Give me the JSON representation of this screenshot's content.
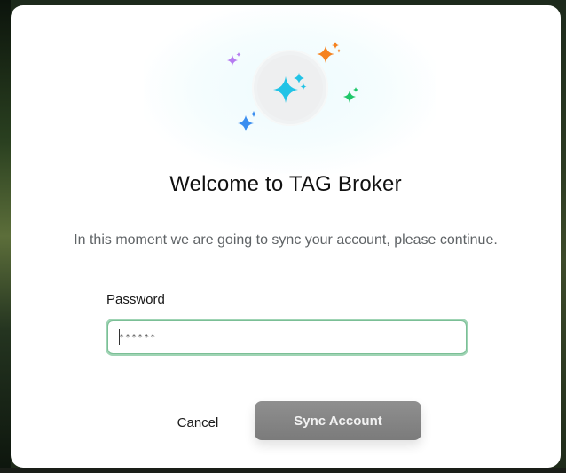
{
  "dialog": {
    "title": "Welcome to TAG Broker",
    "subtitle": "In this moment we are going to sync your account, please continue.",
    "password_label": "Password",
    "password_value": "******",
    "cancel_label": "Cancel",
    "sync_label": "Sync Account"
  },
  "icons": {
    "hero": "sparkles-icon",
    "accents": [
      "purple-sparkle-icon",
      "orange-sparkle-icon",
      "green-sparkle-icon",
      "blue-sparkle-icon"
    ]
  },
  "colors": {
    "hero_sparkle": "#22c3e6",
    "purple_sparkle": "#b57bf0",
    "orange_sparkle": "#f5821f",
    "green_sparkle": "#1fc76a",
    "blue_sparkle": "#3b8ef0",
    "input_focus_border": "#9fd4b4",
    "sync_button_bg": "#858585"
  }
}
